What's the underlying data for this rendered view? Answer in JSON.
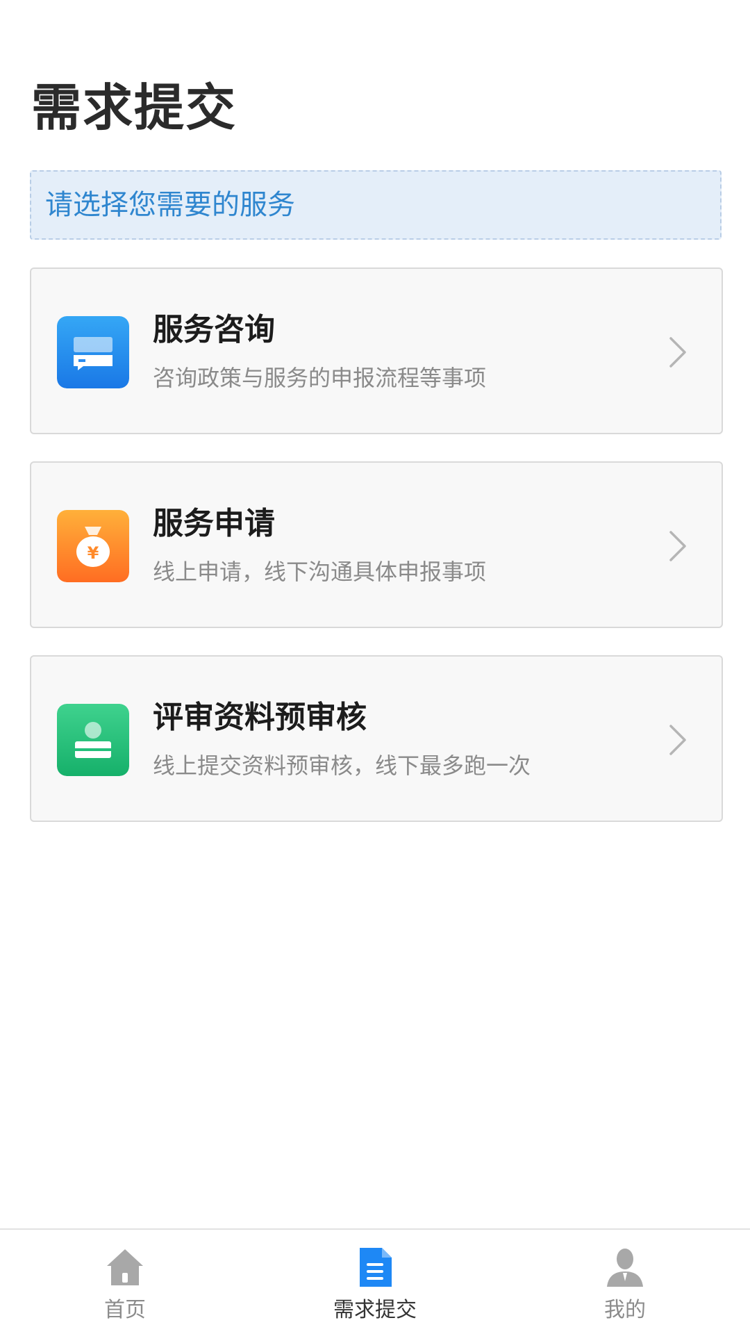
{
  "page": {
    "title": "需求提交"
  },
  "hint": {
    "text": "请选择您需要的服务"
  },
  "services": [
    {
      "title": "服务咨询",
      "desc": "咨询政策与服务的申报流程等事项",
      "icon": "chat-card-icon",
      "color": "#2a8cf0"
    },
    {
      "title": "服务申请",
      "desc": "线上申请，线下沟通具体申报事项",
      "icon": "money-bag-icon",
      "color": "#ff8a2a"
    },
    {
      "title": "评审资料预审核",
      "desc": "线上提交资料预审核，线下最多跑一次",
      "icon": "person-card-icon",
      "color": "#22c07a"
    }
  ],
  "tabbar": {
    "items": [
      {
        "label": "首页",
        "icon": "home-icon",
        "active": false
      },
      {
        "label": "需求提交",
        "icon": "document-icon",
        "active": true
      },
      {
        "label": "我的",
        "icon": "person-icon",
        "active": false
      }
    ],
    "active_color": "#1e88f5",
    "inactive_color": "#a8a8a8"
  }
}
